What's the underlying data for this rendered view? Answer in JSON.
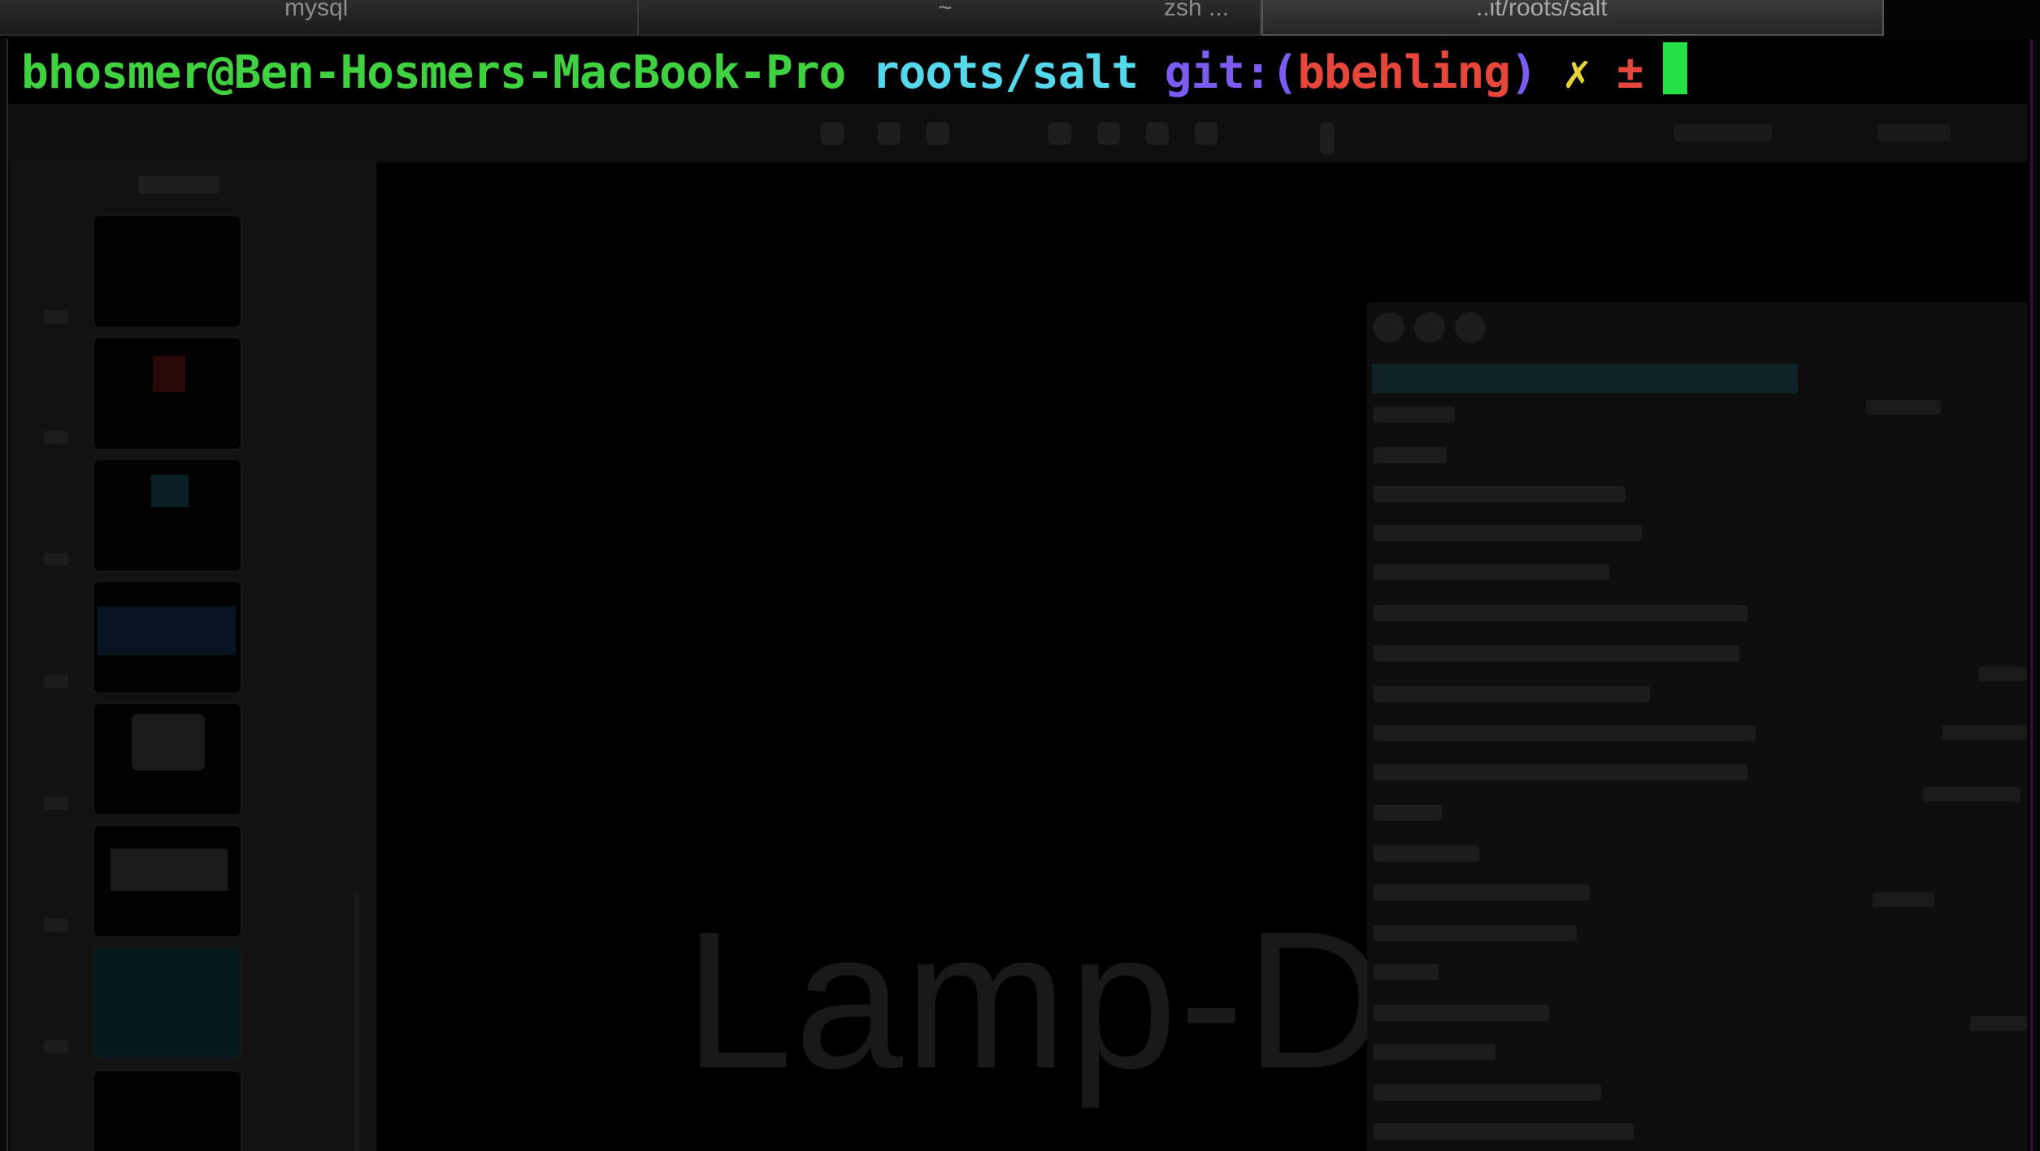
{
  "tabs": [
    {
      "label": "mysql"
    },
    {
      "label": "~"
    },
    {
      "label": "zsh ..."
    },
    {
      "label": "..it/roots/salt"
    }
  ],
  "prompt": {
    "user_host": "bhosmer@Ben-Hosmers-MacBook-Pro",
    "path": "roots/salt",
    "git_prefix": "git:(",
    "branch": "bbehling",
    "git_suffix": ")",
    "dirty_mark": "✗",
    "status_mark": "±"
  },
  "background": {
    "watermark_text": "Lamp-D"
  },
  "colors": {
    "user_host": "#3fd13f",
    "path": "#55d8ec",
    "git": "#7c5cf0",
    "branch": "#e7463a",
    "dirty": "#e6d33a",
    "status": "#e7463a",
    "cursor": "#26e04a"
  }
}
